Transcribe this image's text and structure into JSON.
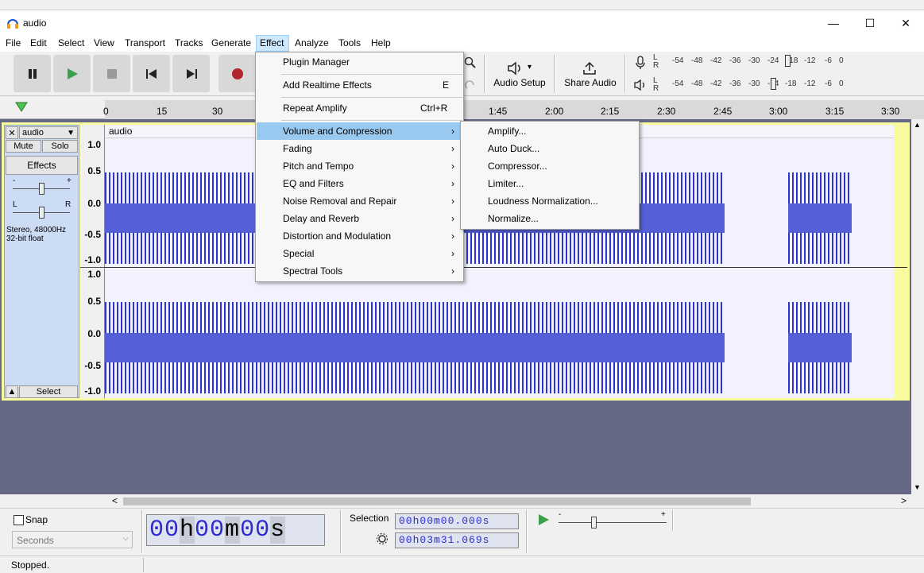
{
  "window": {
    "title": "audio",
    "minimize": "—",
    "maximize": "☐",
    "close": "✕"
  },
  "menubar": [
    "File",
    "Edit",
    "Select",
    "View",
    "Transport",
    "Tracks",
    "Generate",
    "Effect",
    "Analyze",
    "Tools",
    "Help"
  ],
  "toolbar": {
    "audio_setup": "Audio Setup",
    "share_audio": "Share Audio",
    "speaker_dropdown": "▾",
    "meter_scale": [
      "-54",
      "-48",
      "-42",
      "-36",
      "-30",
      "-24",
      "-18",
      "-12",
      "-6",
      "0"
    ],
    "meter_channels": [
      "L",
      "R"
    ]
  },
  "ruler": {
    "ticks": [
      "0",
      "15",
      "30",
      "1:45",
      "2:00",
      "2:15",
      "2:30",
      "2:45",
      "3:00",
      "3:15",
      "3:30"
    ]
  },
  "track": {
    "name": "audio",
    "close": "✕",
    "dropdown": "▼",
    "mute": "Mute",
    "solo": "Solo",
    "effects": "Effects",
    "gain_minus": "-",
    "gain_plus": "+",
    "pan_left": "L",
    "pan_right": "R",
    "info_line1": "Stereo, 48000Hz",
    "info_line2": "32-bit float",
    "collapse": "▲",
    "select": "Select",
    "clip_name": "audio",
    "scale": [
      "1.0",
      "0.5",
      "0.0",
      "-0.5",
      "-1.0"
    ]
  },
  "effect_menu": {
    "items": [
      {
        "label": "Plugin Manager",
        "shortcut": "",
        "submenu": false
      },
      {
        "label": "Add Realtime Effects",
        "shortcut": "E",
        "submenu": false
      },
      {
        "label": "Repeat Amplify",
        "shortcut": "Ctrl+R",
        "submenu": false
      },
      {
        "label": "Volume and Compression",
        "shortcut": "",
        "submenu": true
      },
      {
        "label": "Fading",
        "shortcut": "",
        "submenu": true
      },
      {
        "label": "Pitch and Tempo",
        "shortcut": "",
        "submenu": true
      },
      {
        "label": "EQ and Filters",
        "shortcut": "",
        "submenu": true
      },
      {
        "label": "Noise Removal and Repair",
        "shortcut": "",
        "submenu": true
      },
      {
        "label": "Delay and Reverb",
        "shortcut": "",
        "submenu": true
      },
      {
        "label": "Distortion and Modulation",
        "shortcut": "",
        "submenu": true
      },
      {
        "label": "Special",
        "shortcut": "",
        "submenu": true
      },
      {
        "label": "Spectral Tools",
        "shortcut": "",
        "submenu": true
      }
    ],
    "arrow": "›"
  },
  "volume_submenu": [
    "Amplify...",
    "Auto Duck...",
    "Compressor...",
    "Limiter...",
    "Loudness Normalization...",
    "Normalize..."
  ],
  "bottom": {
    "snap_label": "Snap",
    "snap_unit": "Seconds",
    "time_digits": "00h00m00s",
    "time_h": "00",
    "time_h_unit": "h",
    "time_m": "00",
    "time_m_unit": "m",
    "time_s": "00",
    "time_s_unit": "s",
    "selection_label": "Selection",
    "sel_start": "00h00m00.000s",
    "sel_end": "00h03m31.069s",
    "play_speed_minus": "-",
    "play_speed_plus": "+"
  },
  "status": {
    "text": "Stopped."
  },
  "scroll": {
    "left": "<",
    "right": ">",
    "up": "▲",
    "down": "▼"
  },
  "colors": {
    "waveform": "#5660d6",
    "waveform_dark": "#2b34d0",
    "track_bg": "#656985",
    "selected_item": "#99c9ef",
    "time_text": "#2c2ccc"
  }
}
